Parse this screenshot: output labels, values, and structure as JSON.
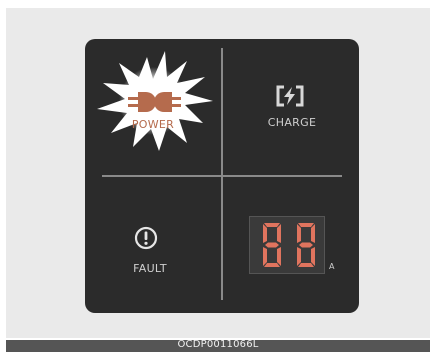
{
  "panel": {
    "power": {
      "label": "POWER",
      "icon": "power-plug-icon",
      "state": "lit",
      "color": "#b56b4d"
    },
    "charge": {
      "label": "CHARGE",
      "icon": "charging-bolt-icon"
    },
    "fault": {
      "label": "FAULT",
      "icon": "exclamation-circle-icon"
    },
    "current": {
      "digits": [
        "8",
        "8"
      ],
      "unit": "A",
      "digit_color": "#e0745e"
    }
  },
  "caption": "OCDP0011066L"
}
